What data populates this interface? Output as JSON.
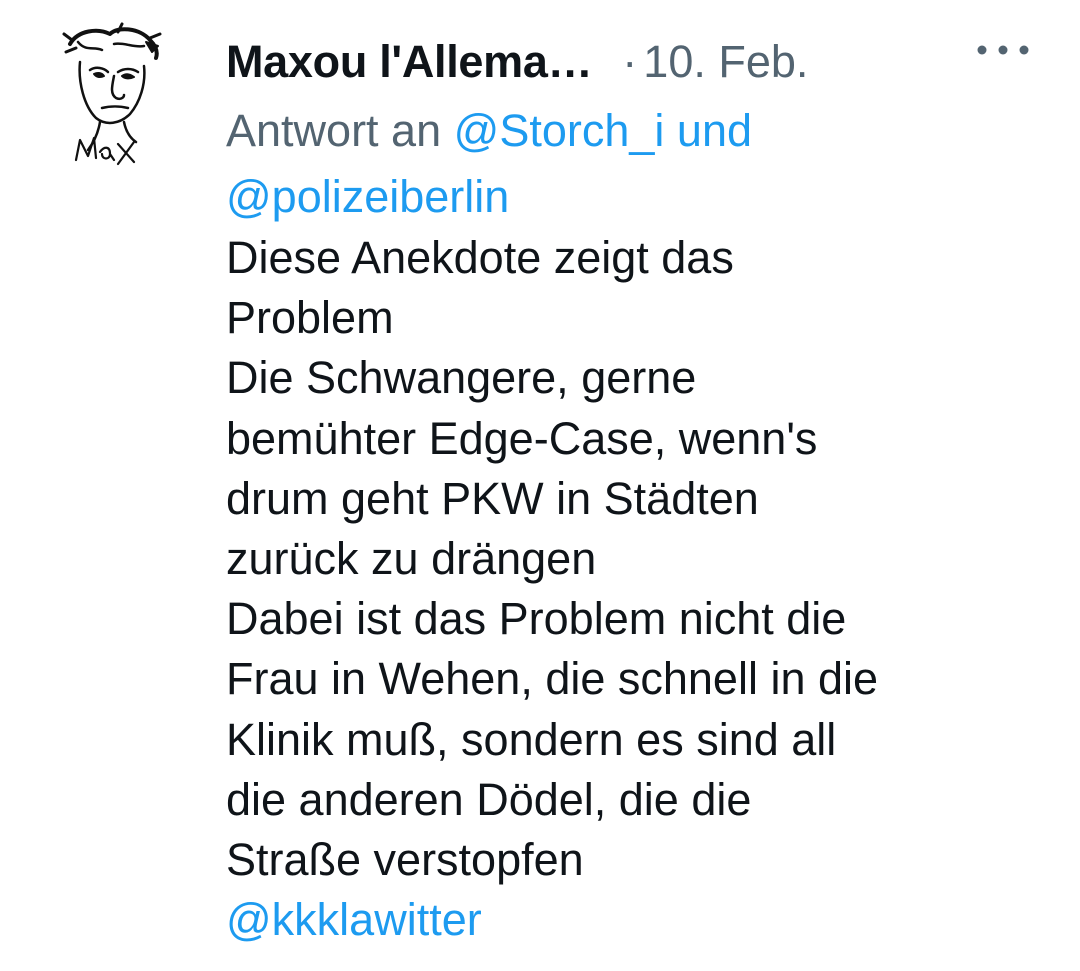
{
  "tweet": {
    "author_name": "Maxou l'Allema…",
    "separator": "·",
    "date": "10. Feb.",
    "reply_prefix": "Antwort an",
    "reply_mention_1": "@Storch_i",
    "reply_and": "und",
    "reply_mention_2": "@polizeiberlin",
    "body_lines": [
      "Diese Anekdote zeigt das",
      "Problem",
      "Die Schwangere, gerne",
      "bemühter Edge-Case, wenn's",
      "drum geht PKW in Städten",
      "zurück zu drängen",
      "Dabei ist das Problem nicht die",
      "Frau in Wehen, die schnell in die",
      "Klinik muß, sondern es sind all",
      "die anderen Dödel, die die",
      "Straße verstopfen"
    ],
    "body_mention": "@kkklawitter",
    "avatar_signature": "Max",
    "more_icon": "more-horizontal-icon"
  },
  "colors": {
    "text": "#0f1419",
    "secondary": "#536471",
    "link": "#1d9bf0",
    "background": "#ffffff"
  }
}
